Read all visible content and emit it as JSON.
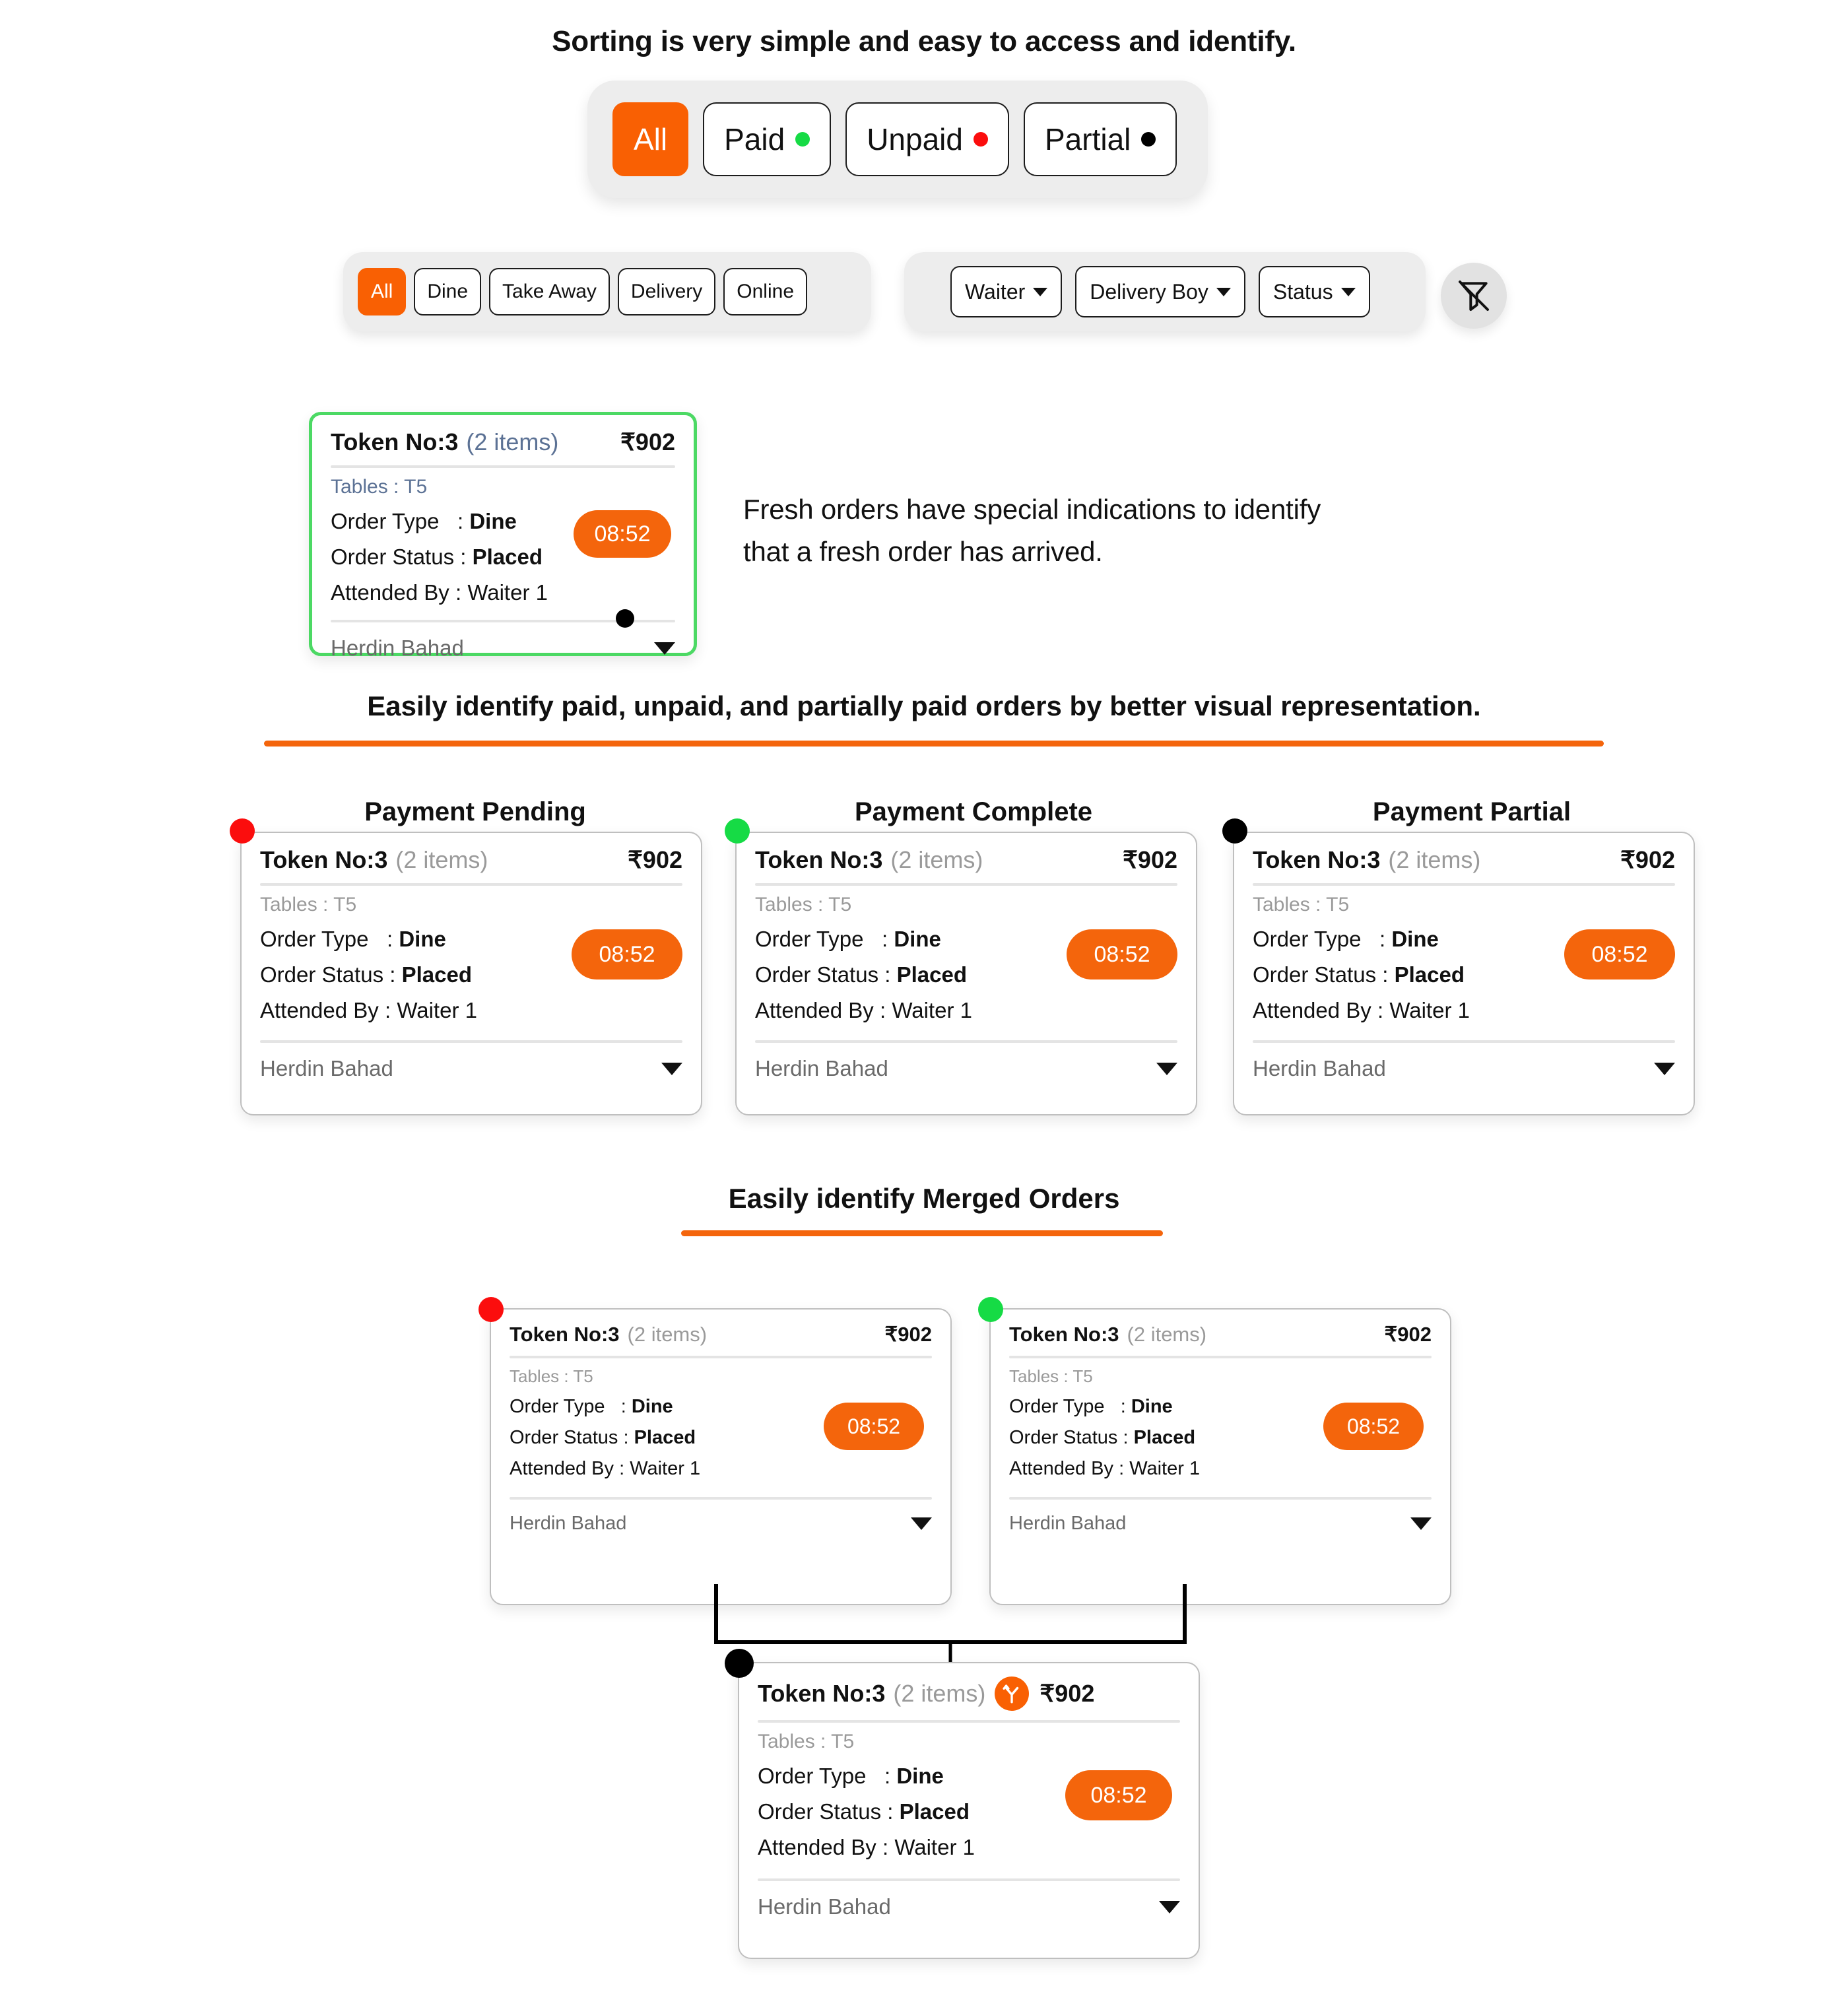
{
  "headings": {
    "sorting_caption": "Sorting is very simple and easy to access and identify.",
    "fresh_order_note_line1": "Fresh orders have special indications to identify",
    "fresh_order_note_line2": "that a fresh order has arrived.",
    "payment_section": "Easily identify paid, unpaid, and partially paid orders by better visual representation.",
    "merged_section": "Easily identify Merged Orders"
  },
  "status_switcher": {
    "options": [
      {
        "label": "All",
        "dot": null,
        "active": true
      },
      {
        "label": "Paid",
        "dot": "green",
        "active": false
      },
      {
        "label": "Unpaid",
        "dot": "red",
        "active": false
      },
      {
        "label": "Partial",
        "dot": "black",
        "active": false
      }
    ]
  },
  "order_type_filter": {
    "options": [
      {
        "label": "All",
        "active": true
      },
      {
        "label": "Dine",
        "active": false
      },
      {
        "label": "Take Away",
        "active": false
      },
      {
        "label": "Delivery",
        "active": false
      },
      {
        "label": "Online",
        "active": false
      }
    ]
  },
  "people_filter": {
    "dropdowns": [
      {
        "label": "Waiter"
      },
      {
        "label": "Delivery Boy"
      },
      {
        "label": "Status"
      }
    ],
    "clear_filter_icon": "filter-off-icon"
  },
  "order": {
    "token_label": "Token No",
    "token_separator": " : ",
    "token_value": "3",
    "items_text": "(2 items)",
    "amount": "₹902",
    "tables_text": "Tables : T5",
    "order_type_key": "Order Type",
    "order_type_sep": ": ",
    "order_type_value": "Dine",
    "order_status_key": "Order Status",
    "order_status_sep": ": ",
    "order_status_value": "Placed",
    "attended_by_key": "Attended By",
    "attended_by_sep": ": ",
    "attended_by_value": "Waiter 1",
    "timer": "08:52",
    "customer_name": "Herdin Bahad",
    "merge_icon": "merge-arrows-icon",
    "expand_icon": "chevron-down-icon"
  },
  "payment_columns": [
    {
      "title": "Payment Pending",
      "marker_color": "#FB0D0D",
      "marker_name": "status-dot-unpaid"
    },
    {
      "title": "Payment Complete",
      "marker_color": "#16DB45",
      "marker_name": "status-dot-paid"
    },
    {
      "title": "Payment Partial",
      "marker_color": "#000000",
      "marker_name": "status-dot-partial"
    }
  ],
  "merged_cards": [
    {
      "marker_color": "#FB0D0D",
      "marker_name": "status-dot-unpaid"
    },
    {
      "marker_color": "#16DB45",
      "marker_name": "status-dot-paid"
    }
  ],
  "merged_result": {
    "marker_color": "#000000",
    "marker_name": "status-dot-partial"
  },
  "colors": {
    "accent_orange": "#F96003",
    "rule_orange": "#F4650C",
    "fresh_green_border": "#4CD964",
    "paid_green": "#16DB45",
    "unpaid_red": "#FB0D0D",
    "partial_black": "#000000",
    "bar_gray": "#EDEDED"
  }
}
